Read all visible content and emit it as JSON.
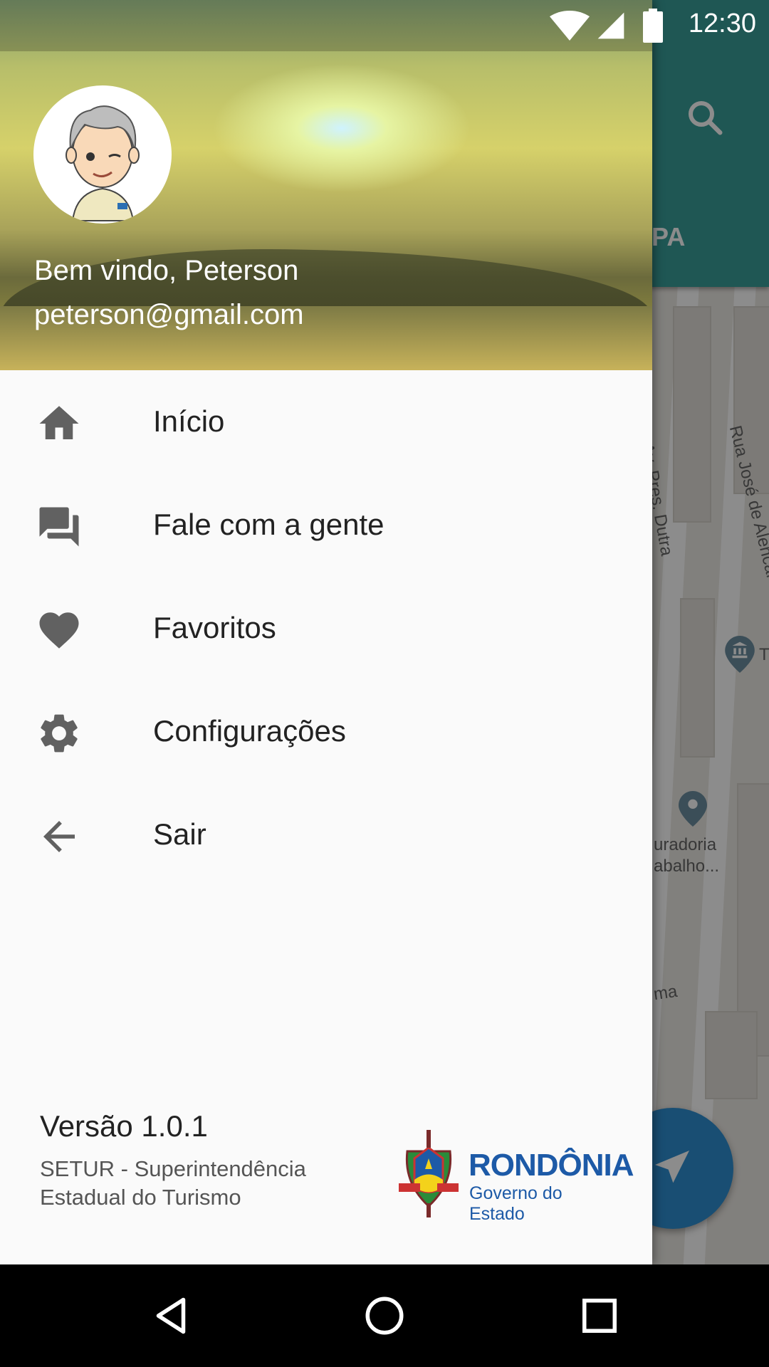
{
  "status_bar": {
    "time": "12:30",
    "icons": [
      "wifi-icon",
      "signal-icon",
      "battery-icon"
    ]
  },
  "drawer": {
    "user_name": "Bem vindo, Peterson",
    "user_email": "peterson@gmail.com",
    "menu": [
      {
        "label": "Início",
        "icon": "home-icon"
      },
      {
        "label": "Fale com a gente",
        "icon": "forum-icon"
      },
      {
        "label": "Favoritos",
        "icon": "heart-icon"
      },
      {
        "label": "Configurações",
        "icon": "settings-icon"
      },
      {
        "label": "Sair",
        "icon": "arrow-back-icon"
      }
    ],
    "footer": {
      "version": "Versão 1.0.1",
      "org_line1": "SETUR - Superintendência",
      "org_line2": "Estadual do Turismo",
      "logo_title": "RONDÔNIA",
      "logo_subtitle": "Governo do Estado"
    }
  },
  "background": {
    "tab_fragment": "PA",
    "street_1": "Av. Pres. Dutra",
    "street_2": "Rua José de Alencar",
    "poi_1": "T",
    "poi_2_line1": "uradoria",
    "poi_2_line2": "abalho...",
    "poi_3": "ma"
  },
  "colors": {
    "appbar": "#3a9f99",
    "fab": "#2f8fd1",
    "drawer_bg": "#fafafa",
    "logo_blue": "#1d5aa7"
  }
}
